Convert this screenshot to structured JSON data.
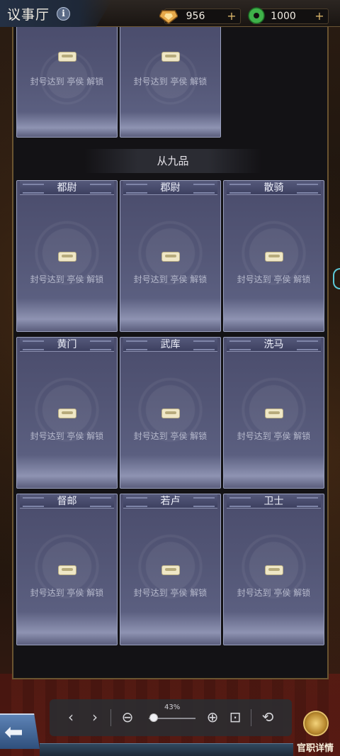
{
  "header": {
    "title": "议事厅",
    "info_icon": "i",
    "resources": [
      {
        "icon": "gold-ingot-icon",
        "value": "956",
        "plus": "+"
      },
      {
        "icon": "jade-coin-icon",
        "value": "1000",
        "plus": "+"
      }
    ]
  },
  "section": {
    "title": "从九品"
  },
  "unlock_text": "封号达到 亭侯 解锁",
  "cards": [
    {
      "title": ""
    },
    {
      "title": ""
    },
    {
      "title": "都尉"
    },
    {
      "title": "郡尉"
    },
    {
      "title": "散骑"
    },
    {
      "title": "黄门"
    },
    {
      "title": "武库"
    },
    {
      "title": "洗马"
    },
    {
      "title": "督邮"
    },
    {
      "title": "若卢"
    },
    {
      "title": "卫士"
    }
  ],
  "toolbar": {
    "prev": "‹",
    "next": "›",
    "zoom_out": "⊖",
    "zoom_label": "43%",
    "zoom_level": 0.43,
    "zoom_in": "⊕",
    "fit": "⊡",
    "rotate": "⟲"
  },
  "details": {
    "label": "官职详情"
  },
  "back": {
    "arrow": "⬅"
  }
}
